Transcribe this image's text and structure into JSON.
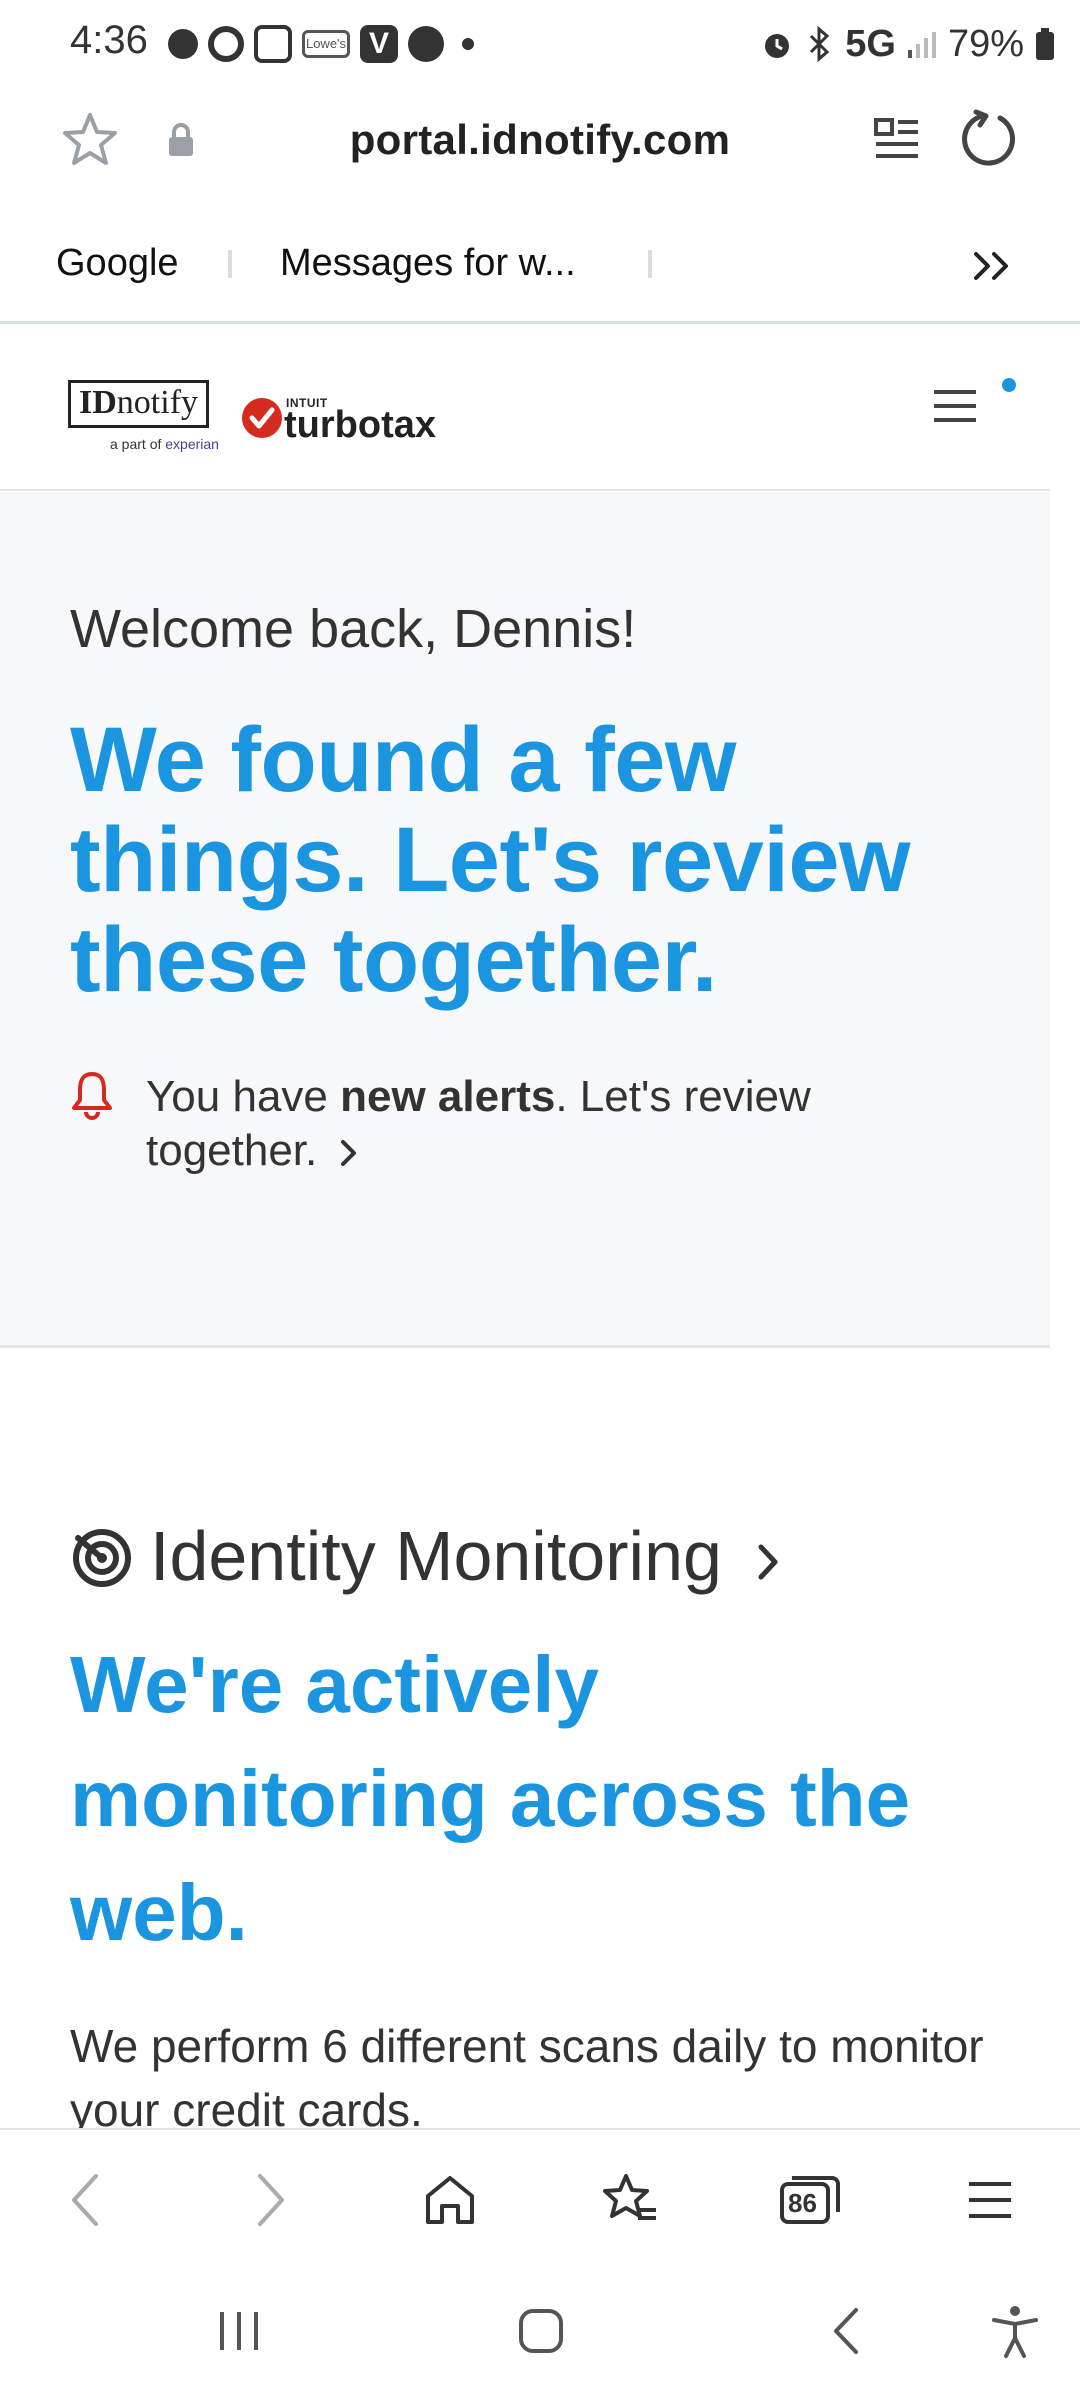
{
  "status_bar": {
    "time": "4:36",
    "notification_icons": [
      "paramount-icon",
      "circle-app-icon",
      "square-app-icon",
      "lowes-icon",
      "v-icon",
      "facebook-icon",
      "more-dot-icon"
    ],
    "lowes_label": "Lowe's",
    "v_label": "V",
    "network": "5G",
    "battery": "79%"
  },
  "browser": {
    "url": "portal.idnotify.com",
    "bookmarks": [
      {
        "label": "Google"
      },
      {
        "label": "Messages for w..."
      }
    ],
    "tabs_count": "86"
  },
  "site": {
    "logo_idnotify": "IDnotify",
    "logo_idnotify_bold": "ID",
    "logo_idnotify_rest": "notify",
    "logo_subtitle_prefix": "a part of",
    "logo_subtitle_brand": "experian",
    "logo_turbotax_intuit": "INTUIT",
    "logo_turbotax": "turbotax"
  },
  "hero": {
    "welcome": "Welcome back, Dennis!",
    "headline": "We found a few things. Let's review these together.",
    "alert_prefix": "You have ",
    "alert_bold": "new alerts",
    "alert_suffix": ". Let's review together."
  },
  "monitoring": {
    "title": "Identity Monitoring",
    "headline": "We're actively monitoring across the web.",
    "body": "We perform 6 different scans daily to monitor your credit cards."
  },
  "colors": {
    "accent_blue": "#1b95e0",
    "alert_red": "#d52b1e",
    "text_dark": "#333333",
    "hero_bg": "#f7f8f9"
  }
}
